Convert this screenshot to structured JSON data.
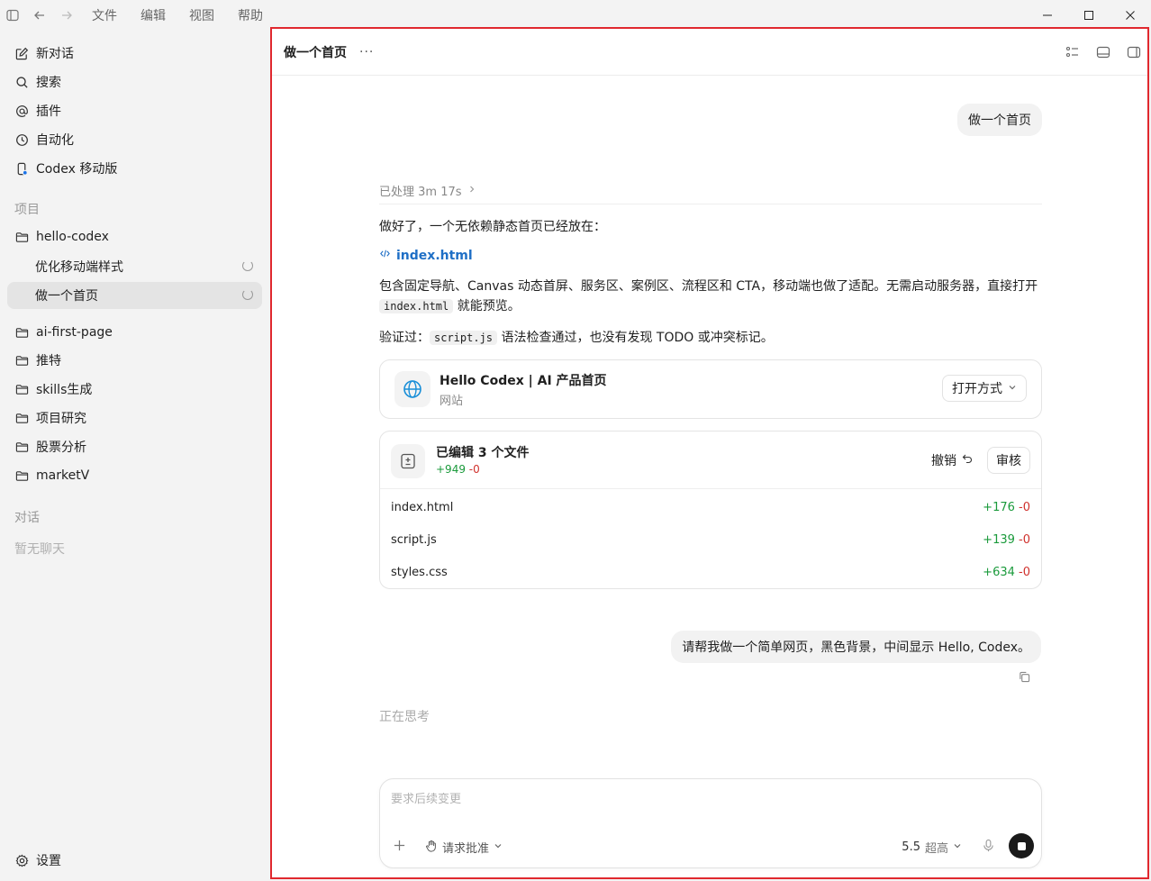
{
  "menu": [
    "文件",
    "编辑",
    "视图",
    "帮助"
  ],
  "sidebar": {
    "top_items": [
      {
        "label": "新对话",
        "icon": "edit-icon"
      },
      {
        "label": "搜索",
        "icon": "search-icon"
      },
      {
        "label": "插件",
        "icon": "at-icon"
      },
      {
        "label": "自动化",
        "icon": "clock-icon"
      },
      {
        "label": "Codex 移动版",
        "icon": "phone-icon"
      }
    ],
    "projects_label": "项目",
    "projects": [
      {
        "label": "hello-codex"
      },
      {
        "label": "优化移动端样式"
      },
      {
        "label": "做一个首页"
      },
      {
        "label": "ai-first-page"
      },
      {
        "label": "推特"
      },
      {
        "label": "skills生成"
      },
      {
        "label": "项目研究"
      },
      {
        "label": "股票分析"
      },
      {
        "label": "marketV"
      }
    ],
    "chats_label": "对话",
    "no_chats": "暂无聊天",
    "settings": "设置"
  },
  "main": {
    "title": "做一个首页",
    "more": "···",
    "user_message_1": "做一个首页",
    "processed": "已处理 3m 17s",
    "reply_intro": "做好了，一个无依赖静态首页已经放在：",
    "file_link": "index.html",
    "reply_desc_1": "包含固定导航、Canvas 动态首屏、服务区、案例区、流程区和 CTA，移动端也做了适配。无需启动服务器，直接打开",
    "reply_desc_code": "index.html",
    "reply_desc_2": " 就能预览。",
    "verify_prefix": "验证过：",
    "verify_code": "script.js",
    "verify_suffix": " 语法检查通过，也没有发现 TODO 或冲突标记。",
    "site_card": {
      "title": "Hello Codex | AI 产品首页",
      "subtitle": "网站",
      "open_label": "打开方式"
    },
    "edits": {
      "title": "已编辑 3 个文件",
      "added": "+949",
      "removed": "-0",
      "undo": "撤销",
      "review": "审核",
      "files": [
        {
          "name": "index.html",
          "added": "+176",
          "removed": "-0"
        },
        {
          "name": "script.js",
          "added": "+139",
          "removed": "-0"
        },
        {
          "name": "styles.css",
          "added": "+634",
          "removed": "-0"
        }
      ]
    },
    "user_message_2": "请帮我做一个简单网页，黑色背景，中间显示 Hello, Codex。",
    "thinking": "正在思考",
    "composer": {
      "placeholder": "要求后续变更",
      "approval": "请求批准",
      "model_version": "5.5",
      "model_mode": "超高"
    }
  }
}
